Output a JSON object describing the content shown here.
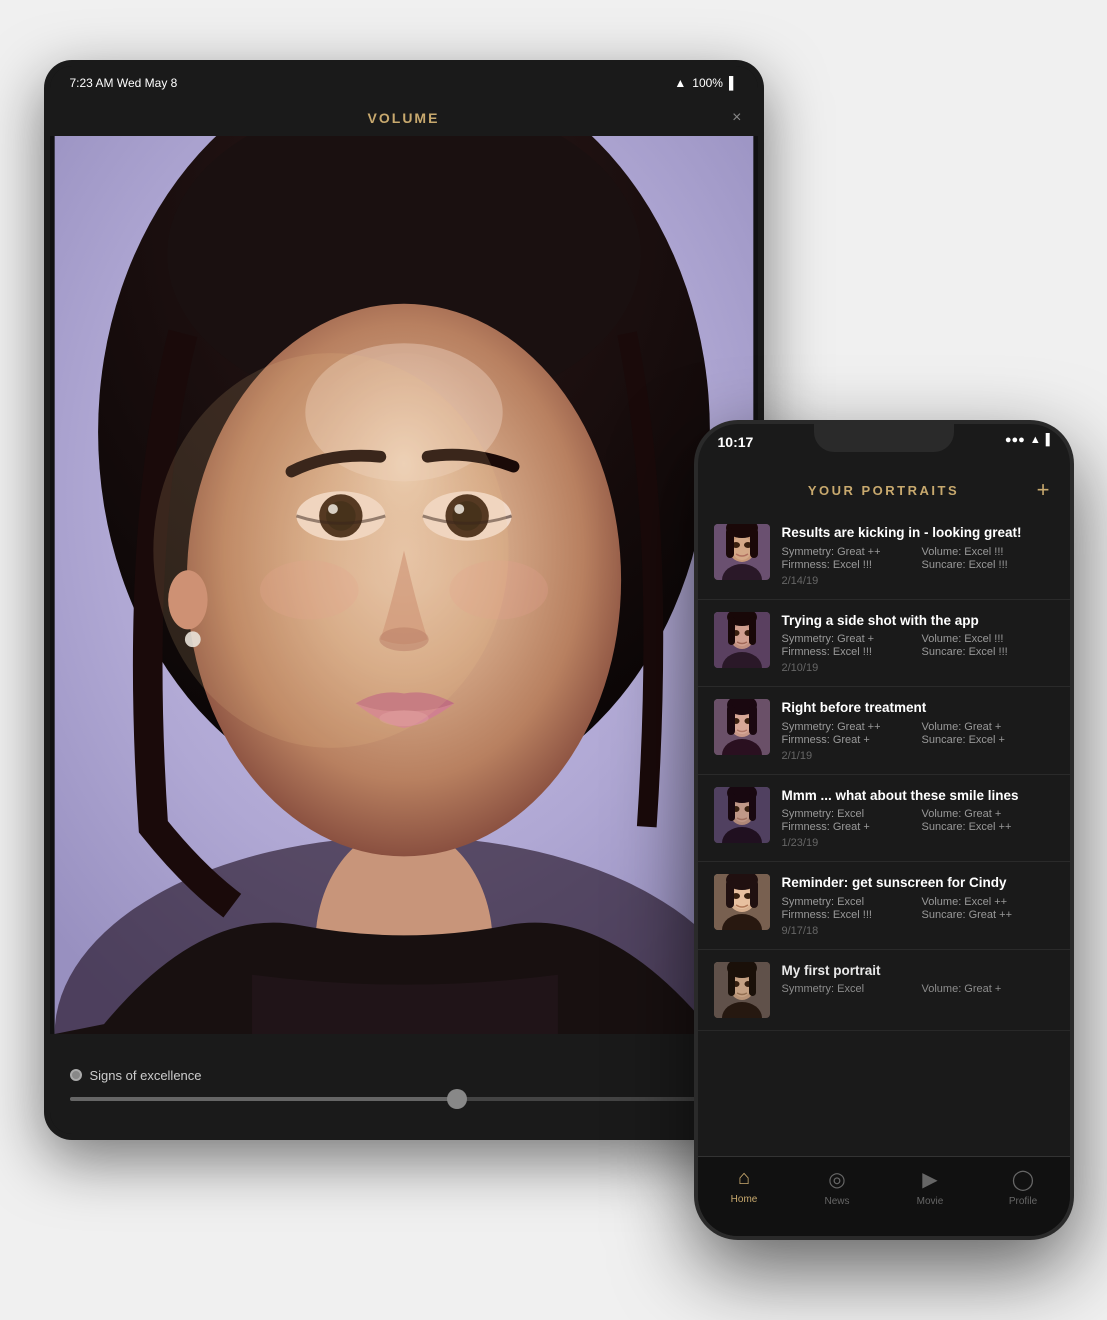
{
  "tablet": {
    "status": {
      "time": "7:23 AM  Wed May 8",
      "battery": "100%"
    },
    "title": "VOLUME",
    "close_icon": "×",
    "bottom": {
      "signs_label": "Signs of excellence",
      "slider_percent": 58
    }
  },
  "phone": {
    "status": {
      "time": "10:17"
    },
    "header": {
      "title": "YOUR PORTRAITS",
      "add_icon": "+"
    },
    "portraits": [
      {
        "id": 1,
        "title": "Results are kicking in - looking great!",
        "metrics": [
          "Symmetry: Great ++",
          "Volume: Excel !!!",
          "Firmness: Excel !!!",
          "Suncare: Excel !!!"
        ],
        "date": "2/14/19",
        "thumb_class": "thumb-1"
      },
      {
        "id": 2,
        "title": "Trying a side shot with the app",
        "metrics": [
          "Symmetry: Great +",
          "Volume: Excel !!!",
          "Firmness: Excel !!!",
          "Suncare: Excel !!!"
        ],
        "date": "2/10/19",
        "thumb_class": "thumb-2"
      },
      {
        "id": 3,
        "title": "Right before treatment",
        "metrics": [
          "Symmetry: Great ++",
          "Volume: Great +",
          "Firmness: Great +",
          "Suncare: Excel +"
        ],
        "date": "2/1/19",
        "thumb_class": "thumb-3"
      },
      {
        "id": 4,
        "title": "Mmm ... what about these smile lines",
        "metrics": [
          "Symmetry: Excel",
          "Volume: Great +",
          "Firmness: Great +",
          "Suncare: Excel ++"
        ],
        "date": "1/23/19",
        "thumb_class": "thumb-4"
      },
      {
        "id": 5,
        "title": "Reminder: get sunscreen for Cindy",
        "metrics": [
          "Symmetry: Excel",
          "Volume: Excel ++",
          "Firmness: Excel !!!",
          "Suncare: Great ++"
        ],
        "date": "9/17/18",
        "thumb_class": "thumb-5"
      },
      {
        "id": 6,
        "title": "My first portrait",
        "metrics": [
          "Symmetry: Excel",
          "Volume: Great +"
        ],
        "date": "",
        "thumb_class": "thumb-6"
      }
    ],
    "tabs": [
      {
        "id": "home",
        "label": "Home",
        "icon": "⌂",
        "active": true
      },
      {
        "id": "news",
        "label": "News",
        "icon": "◎",
        "active": false
      },
      {
        "id": "movie",
        "label": "Movie",
        "icon": "▶",
        "active": false
      },
      {
        "id": "profile",
        "label": "Profile",
        "icon": "◯",
        "active": false
      }
    ]
  }
}
